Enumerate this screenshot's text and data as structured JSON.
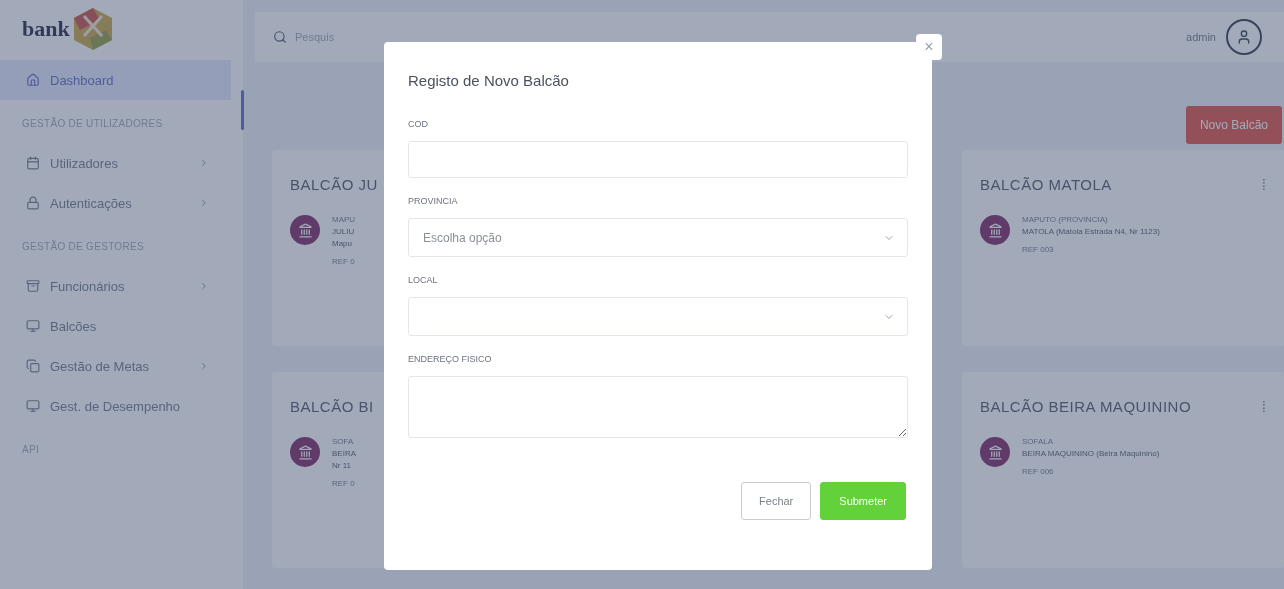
{
  "logo": {
    "text": "bank"
  },
  "sidebar": {
    "items": [
      {
        "kind": "link",
        "label": "Dashboard",
        "selected": true,
        "has_submenu": false
      },
      {
        "kind": "heading",
        "label": "GESTÃO DE UTILIZADORES"
      },
      {
        "kind": "link",
        "label": "Utilizadores",
        "selected": false,
        "has_submenu": true
      },
      {
        "kind": "link",
        "label": "Autenticações",
        "selected": false,
        "has_submenu": true
      },
      {
        "kind": "heading",
        "label": "GESTÃO DE GESTORES"
      },
      {
        "kind": "link",
        "label": "Funcionários",
        "selected": false,
        "has_submenu": true
      },
      {
        "kind": "link",
        "label": "Balcões",
        "selected": false,
        "has_submenu": false
      },
      {
        "kind": "link",
        "label": "Gestão de Metas",
        "selected": false,
        "has_submenu": true
      },
      {
        "kind": "link",
        "label": "Gest. de Desempenho",
        "selected": false,
        "has_submenu": false
      },
      {
        "kind": "heading",
        "label": "API"
      }
    ]
  },
  "topbar": {
    "search": {
      "placeholder": "Pesquis"
    },
    "user": "admin"
  },
  "new_button": "Novo Balcão",
  "cards": [
    {
      "title": "BALCÃO JU",
      "province": "MAPU",
      "address": "JULIU",
      "address_2": "Mapu",
      "ref": "REF 0"
    },
    {
      "title": "BALCÃO MATOLA",
      "province": "MAPUTO (PROVINCIA)",
      "address": "MATOLA (Matola Estrada N4, Nr 1123)",
      "ref": "REF 003",
      "menu": "⁞"
    },
    {
      "title": "BALCÃO BI",
      "province": "SOFA",
      "address": "BEIRA",
      "address_2": "Nr 11",
      "ref": "REF 0"
    },
    {
      "title": "BALCÃO BEIRA MAQUININO",
      "province": "SOFALA",
      "address": "BEIRA MAQUININO (Beira Maquinino)",
      "ref": "REF 006",
      "menu": "⁞"
    }
  ],
  "modal": {
    "title": "Registo de Novo Balcão",
    "close": "×",
    "fields": [
      {
        "kind": "text",
        "label": "COD"
      },
      {
        "kind": "select",
        "label": "PROVINCIA",
        "placeholder": "Escolha opção"
      },
      {
        "kind": "select",
        "label": "LOCAL"
      },
      {
        "kind": "textarea",
        "label": "ENDEREÇO FISICO"
      }
    ],
    "buttons": [
      {
        "kind": "secondary",
        "label": "Fechar"
      },
      {
        "kind": "primary",
        "label": "Submeter"
      }
    ]
  }
}
